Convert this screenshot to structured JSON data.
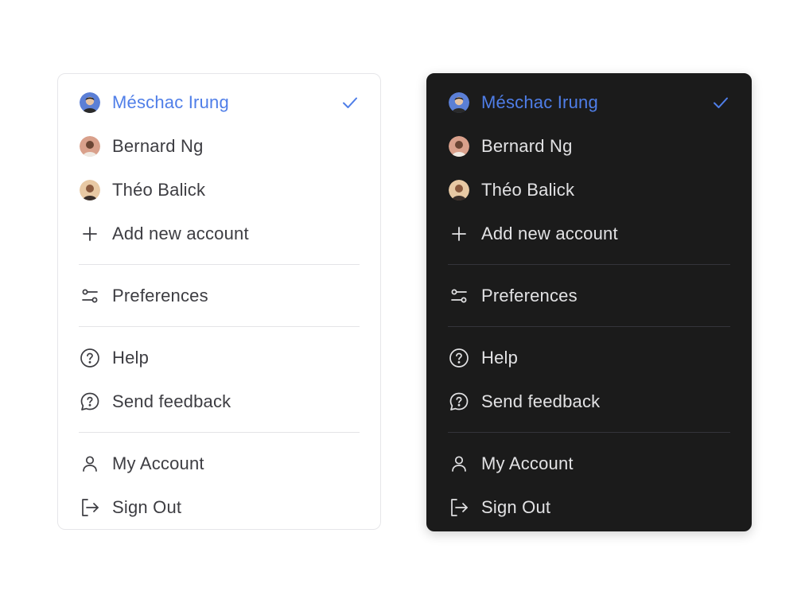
{
  "colors": {
    "accent": "#4f7ee8",
    "light_bg": "#ffffff",
    "dark_bg": "#1b1b1b"
  },
  "light_menu": {
    "accounts": [
      {
        "name": "Méschac Irung",
        "active": true
      },
      {
        "name": "Bernard Ng",
        "active": false
      },
      {
        "name": "Théo Balick",
        "active": false
      }
    ],
    "add_account_label": "Add new account",
    "preferences_label": "Preferences",
    "help_label": "Help",
    "feedback_label": "Send feedback",
    "my_account_label": "My Account",
    "sign_out_label": "Sign Out"
  },
  "dark_menu": {
    "accounts": [
      {
        "name": "Méschac Irung",
        "active": true
      },
      {
        "name": "Bernard Ng",
        "active": false
      },
      {
        "name": "Théo Balick",
        "active": false
      }
    ],
    "add_account_label": "Add new account",
    "preferences_label": "Preferences",
    "help_label": "Help",
    "feedback_label": "Send feedback",
    "my_account_label": "My Account",
    "sign_out_label": "Sign Out"
  },
  "icons": {
    "check": "check-icon",
    "add": "plus-icon",
    "preferences": "sliders-icon",
    "help": "question-circle-icon",
    "feedback": "message-question-icon",
    "account": "user-icon",
    "sign_out": "sign-out-icon"
  }
}
